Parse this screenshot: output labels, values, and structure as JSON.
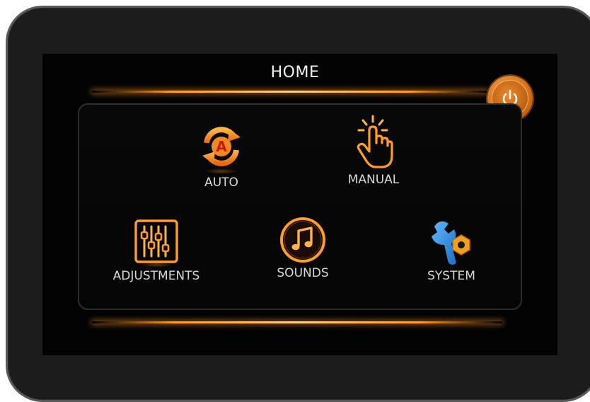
{
  "screen": {
    "title": "HOME"
  },
  "power_button": {
    "icon": "power-icon"
  },
  "tiles": [
    {
      "id": "auto",
      "label": "AUTO",
      "icon": "auto-cycle-icon"
    },
    {
      "id": "manual",
      "label": "MANUAL",
      "icon": "touch-hand-icon"
    },
    {
      "id": "adjustments",
      "label": "ADJUSTMENTS",
      "icon": "sliders-icon"
    },
    {
      "id": "sounds",
      "label": "SOUNDS",
      "icon": "music-note-icon"
    },
    {
      "id": "system",
      "label": "SYSTEM",
      "icon": "wrench-gear-icon"
    }
  ],
  "colors": {
    "accent": "#ff9b2a",
    "system_blue": "#2f8fe0",
    "background": "#030303",
    "bezel": "#1c1c1c"
  }
}
